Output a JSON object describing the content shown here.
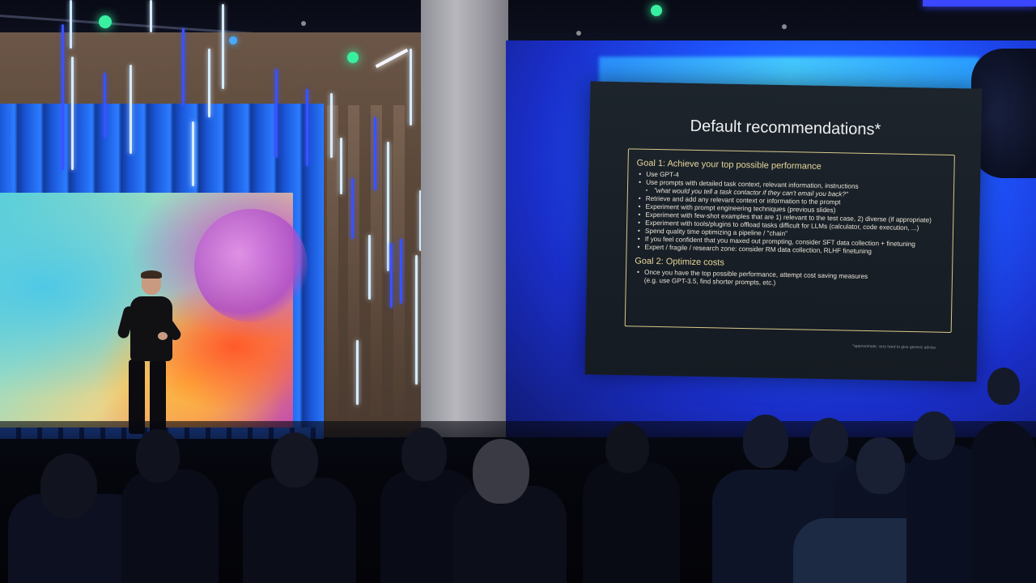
{
  "slide": {
    "title": "Default recommendations*",
    "goal1": {
      "heading": "Goal 1: Achieve your top possible performance",
      "bullets": [
        "Use GPT-4",
        "Use prompts with detailed task context, relevant information, instructions",
        "Retrieve and add any relevant context or information to the prompt",
        "Experiment with prompt engineering techniques (previous slides)",
        "Experiment with few-shot examples that are 1) relevant to the test case, 2) diverse (if appropriate)",
        "Experiment with tools/plugins to offload tasks difficult for LLMs (calculator, code execution, ...)",
        "Spend quality time optimizing a pipeline / \"chain\"",
        "If you feel confident that you maxed out prompting, consider SFT data collection + finetuning",
        "Expert / fragile / research zone: consider RM data collection, RLHF finetuning"
      ],
      "sub_bullet": "\"what would you tell a task contactor if they can't email you back?\""
    },
    "goal2": {
      "heading": "Goal 2: Optimize costs",
      "bullets": [
        "Once you have the top possible performance, attempt cost saving measures",
        "(e.g. use GPT-3.5, find shorter prompts, etc.)"
      ]
    },
    "footnote": "*approximate, very hard to give generic advice"
  },
  "colors": {
    "slide_bg": "#1a2028",
    "box_border": "#d8c98a",
    "goal_heading": "#e6d79a",
    "stage_blue": "#1e56ff"
  }
}
